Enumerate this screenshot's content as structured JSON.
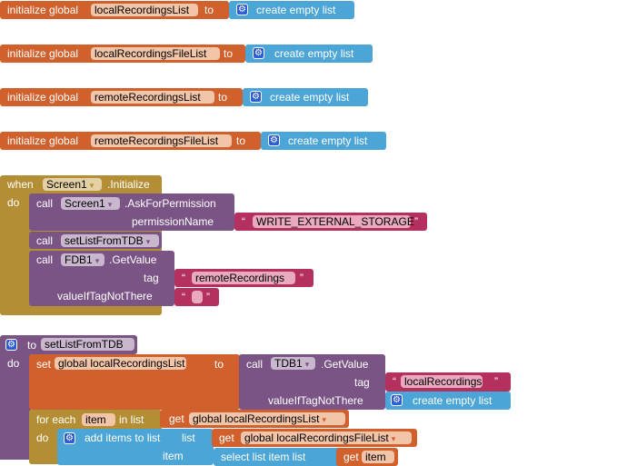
{
  "globals": [
    {
      "prefix": "initialize global",
      "name": "localRecordingsList",
      "to": "to",
      "value": "create empty list"
    },
    {
      "prefix": "initialize global",
      "name": "localRecordingsFileList",
      "to": "to",
      "value": "create empty list"
    },
    {
      "prefix": "initialize global",
      "name": "remoteRecordingsList",
      "to": "to",
      "value": "create empty list"
    },
    {
      "prefix": "initialize global",
      "name": "remoteRecordingsFileList",
      "to": "to",
      "value": "create empty list"
    }
  ],
  "event": {
    "when": "when",
    "component": "Screen1",
    "event": ".Initialize",
    "do": "do",
    "ask": {
      "call": "call",
      "component": "Screen1",
      "method": ".AskForPermission",
      "param": "permissionName",
      "value": "WRITE_EXTERNAL_STORAGE"
    },
    "setlist": {
      "call": "call",
      "proc": "setListFromTDB"
    },
    "fdb": {
      "call": "call",
      "component": "FDB1",
      "method": ".GetValue",
      "tag_label": "tag",
      "tag": "remoteRecordings",
      "default_label": "valueIfTagNotThere",
      "default": ""
    }
  },
  "proc": {
    "to": "to",
    "name": "setListFromTDB",
    "do": "do",
    "set": {
      "set": "set",
      "var": "global localRecordingsList",
      "to": "to"
    },
    "tdb": {
      "call": "call",
      "component": "TDB1",
      "method": ".GetValue",
      "tag_label": "tag",
      "tag": "localRecordings",
      "default_label": "valueIfTagNotThere",
      "default": "create empty list"
    },
    "foreach": {
      "label": "for each",
      "var": "item",
      "in": "in list",
      "get": "get",
      "list": "global localRecordingsList",
      "do": "do"
    },
    "add": {
      "label": "add items to list",
      "list_label": "list",
      "get": "get",
      "list": "global localRecordingsFileList",
      "item_label": "item",
      "select": "select list item list",
      "get2": "get",
      "item": "item"
    }
  },
  "quote_open": "“",
  "quote_close": "”",
  "dropdown": "▾",
  "gear": "⚙"
}
